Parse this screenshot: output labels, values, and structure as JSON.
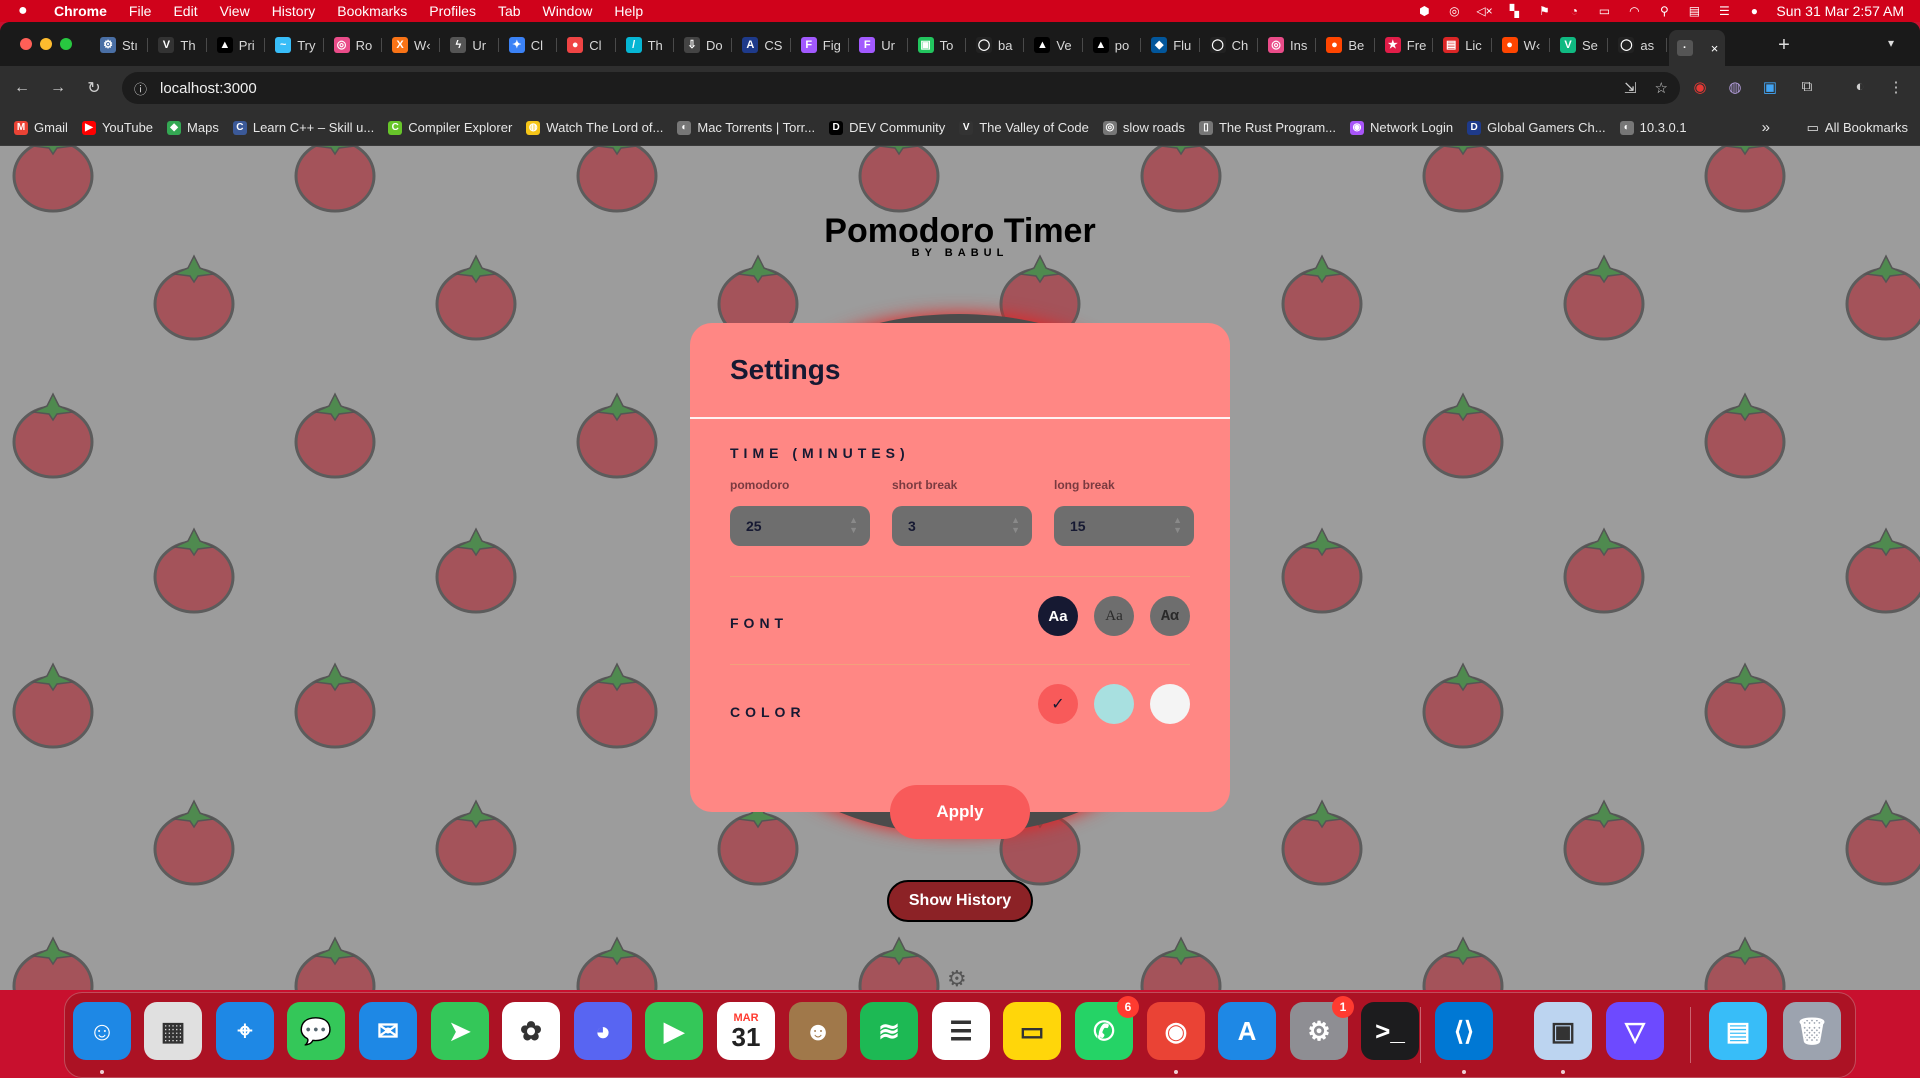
{
  "menubar": {
    "app": "Chrome",
    "items": [
      "File",
      "Edit",
      "View",
      "History",
      "Bookmarks",
      "Profiles",
      "Tab",
      "Window",
      "Help"
    ],
    "clock": "Sun 31 Mar  2:57 AM"
  },
  "tabs": [
    {
      "label": "Stı",
      "fav": "⚙",
      "color": "#4a6fa5"
    },
    {
      "label": "Th",
      "fav": "V",
      "color": "#333333"
    },
    {
      "label": "Pri",
      "fav": "▲",
      "color": "#000000"
    },
    {
      "label": "Try",
      "fav": "~",
      "color": "#38bdf8"
    },
    {
      "label": "Ro",
      "fav": "◎",
      "color": "#ea4c89"
    },
    {
      "label": "W‹",
      "fav": "X",
      "color": "#f97316"
    },
    {
      "label": "Ur",
      "fav": "ϟ",
      "color": "#555555"
    },
    {
      "label": "Cl",
      "fav": "✦",
      "color": "#3b82f6"
    },
    {
      "label": "Cl",
      "fav": "●",
      "color": "#ef4444"
    },
    {
      "label": "Th",
      "fav": "/",
      "color": "#06b6d4"
    },
    {
      "label": "Do",
      "fav": "⇩",
      "color": "#444444"
    },
    {
      "label": "CS",
      "fav": "A",
      "color": "#1e3a8a"
    },
    {
      "label": "Fig",
      "fav": "F",
      "color": "#a259ff"
    },
    {
      "label": "Ur",
      "fav": "F",
      "color": "#a259ff"
    },
    {
      "label": "To",
      "fav": "▣",
      "color": "#22c55e"
    },
    {
      "label": "ba",
      "fav": "◯",
      "color": "#222222"
    },
    {
      "label": "Ve",
      "fav": "▲",
      "color": "#000000"
    },
    {
      "label": "po",
      "fav": "▲",
      "color": "#000000"
    },
    {
      "label": "Flu",
      "fav": "◆",
      "color": "#02569b"
    },
    {
      "label": "Ch",
      "fav": "◯",
      "color": "#222222"
    },
    {
      "label": "Ins",
      "fav": "◎",
      "color": "#ea4c89"
    },
    {
      "label": "Be",
      "fav": "●",
      "color": "#ff4500"
    },
    {
      "label": "Fre",
      "fav": "★",
      "color": "#e11d48"
    },
    {
      "label": "Lic",
      "fav": "▤",
      "color": "#dc2626"
    },
    {
      "label": "W‹",
      "fav": "●",
      "color": "#ff4500"
    },
    {
      "label": "Se",
      "fav": "V",
      "color": "#10b981"
    },
    {
      "label": "as",
      "fav": "◯",
      "color": "#222222"
    },
    {
      "label": "",
      "fav": "·",
      "color": "#555555"
    }
  ],
  "omnibox": {
    "url": "localhost:3000"
  },
  "bookmarks": [
    {
      "label": "Gmail",
      "fav": "M",
      "color": "#ea4335"
    },
    {
      "label": "YouTube",
      "fav": "▶",
      "color": "#ff0000"
    },
    {
      "label": "Maps",
      "fav": "◆",
      "color": "#34a853"
    },
    {
      "label": "Learn C++ – Skill u...",
      "fav": "C",
      "color": "#3b5998"
    },
    {
      "label": "Compiler Explorer",
      "fav": "C",
      "color": "#67c52a"
    },
    {
      "label": "Watch The Lord of...",
      "fav": "◍",
      "color": "#f5c518"
    },
    {
      "label": "Mac Torrents | Torr...",
      "fav": "◐",
      "color": "#777777"
    },
    {
      "label": "DEV Community",
      "fav": "D",
      "color": "#000000"
    },
    {
      "label": "The Valley of Code",
      "fav": "V",
      "color": "#333333"
    },
    {
      "label": "slow roads",
      "fav": "◎",
      "color": "#777777"
    },
    {
      "label": "The Rust Program...",
      "fav": "▯",
      "color": "#777777"
    },
    {
      "label": "Network Login",
      "fav": "◉",
      "color": "#a855f7"
    },
    {
      "label": "Global Gamers Ch...",
      "fav": "D",
      "color": "#1e3a8a"
    },
    {
      "label": "10.3.0.1",
      "fav": "◐",
      "color": "#777777"
    }
  ],
  "all_bookmarks": "All Bookmarks",
  "app": {
    "title": "Pomodoro Timer",
    "subtitle": "BY BABUL",
    "show_history": "Show History"
  },
  "settings": {
    "title": "Settings",
    "time_heading": "TIME (MINUTES)",
    "fields": [
      {
        "label": "pomodoro",
        "value": "25"
      },
      {
        "label": "short break",
        "value": "3"
      },
      {
        "label": "long break",
        "value": "15"
      }
    ],
    "font_heading": "FONT",
    "font_options": [
      {
        "label": "Aa",
        "selected": true
      },
      {
        "label": "Aa",
        "selected": false
      },
      {
        "label": "Aα",
        "selected": false
      }
    ],
    "color_heading": "COLOR",
    "color_options": [
      {
        "hex": "#f85a5a",
        "selected": true,
        "check": "✓"
      },
      {
        "hex": "#a8e0e0",
        "selected": false,
        "check": ""
      },
      {
        "hex": "#f4f4f4",
        "selected": false,
        "check": ""
      }
    ],
    "apply": "Apply"
  },
  "colors": {
    "accent": "#f85a5a",
    "modal_bg": "#ff8784",
    "dark": "#161932"
  },
  "dock": [
    {
      "name": "finder",
      "glyph": "☺",
      "color": "#1e88e5",
      "dot": true
    },
    {
      "name": "launchpad",
      "glyph": "▦",
      "color": "#e0e0e0",
      "dot": false
    },
    {
      "name": "safari",
      "glyph": "⌖",
      "color": "#1e88e5",
      "dot": false
    },
    {
      "name": "messages",
      "glyph": "💬",
      "color": "#34c759",
      "dot": false
    },
    {
      "name": "mail",
      "glyph": "✉",
      "color": "#1e88e5",
      "dot": false
    },
    {
      "name": "maps",
      "glyph": "➤",
      "color": "#34c759",
      "dot": false
    },
    {
      "name": "photos",
      "glyph": "✿",
      "color": "#ffffff",
      "dot": false
    },
    {
      "name": "discord",
      "glyph": "◕",
      "color": "#5865f2",
      "dot": false
    },
    {
      "name": "facetime",
      "glyph": "▶",
      "color": "#34c759",
      "dot": false
    },
    {
      "name": "calendar",
      "glyph": "31",
      "color": "#ffffff",
      "dot": false,
      "top": "MAR"
    },
    {
      "name": "contacts",
      "glyph": "☻",
      "color": "#a0784a",
      "dot": false
    },
    {
      "name": "spotify",
      "glyph": "≋",
      "color": "#1db954",
      "dot": false
    },
    {
      "name": "reminders",
      "glyph": "☰",
      "color": "#ffffff",
      "dot": false
    },
    {
      "name": "notes",
      "glyph": "▭",
      "color": "#ffd60a",
      "dot": false
    },
    {
      "name": "whatsapp",
      "glyph": "✆",
      "color": "#25d366",
      "dot": false,
      "badge": "6"
    },
    {
      "name": "chrome",
      "glyph": "◉",
      "color": "#ea4335",
      "dot": true
    },
    {
      "name": "app-store",
      "glyph": "A",
      "color": "#1e88e5",
      "dot": false
    },
    {
      "name": "system-settings",
      "glyph": "⚙",
      "color": "#8e8e93",
      "dot": false,
      "badge": "1"
    },
    {
      "name": "terminal",
      "glyph": ">_",
      "color": "#1c1c1e",
      "dot": false
    },
    {
      "name": "vscode",
      "glyph": "⟨⟩",
      "color": "#0078d4",
      "dot": true
    },
    {
      "name": "preview",
      "glyph": "▣",
      "color": "#bcd4f0",
      "dot": true
    },
    {
      "name": "proton-vpn",
      "glyph": "▽",
      "color": "#6d4aff",
      "dot": false
    },
    {
      "name": "downloads-folder",
      "glyph": "▤",
      "color": "#38bdf8",
      "dot": false
    },
    {
      "name": "trash",
      "glyph": "🗑",
      "color": "#9ca3af",
      "dot": false
    }
  ]
}
